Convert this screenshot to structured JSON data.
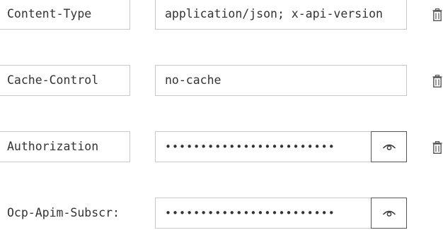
{
  "headers": [
    {
      "name": "Content-Type",
      "value": "application/json; x-api-version",
      "masked": false,
      "has_delete": true
    },
    {
      "name": "Cache-Control",
      "value": "no-cache",
      "masked": false,
      "has_delete": true
    },
    {
      "name": "Authorization",
      "value": "••••••••••••••••••••••••",
      "masked": true,
      "has_delete": true
    },
    {
      "name": "Ocp-Apim-Subscr:",
      "value": "••••••••••••••••••••••••",
      "masked": true,
      "has_delete": false
    }
  ],
  "icons": {
    "reveal": "eye-icon",
    "delete": "trash-icon"
  },
  "colors": {
    "border": "#c8c8c8",
    "button_border": "#555555",
    "text": "#333333",
    "icon": "#555555"
  }
}
